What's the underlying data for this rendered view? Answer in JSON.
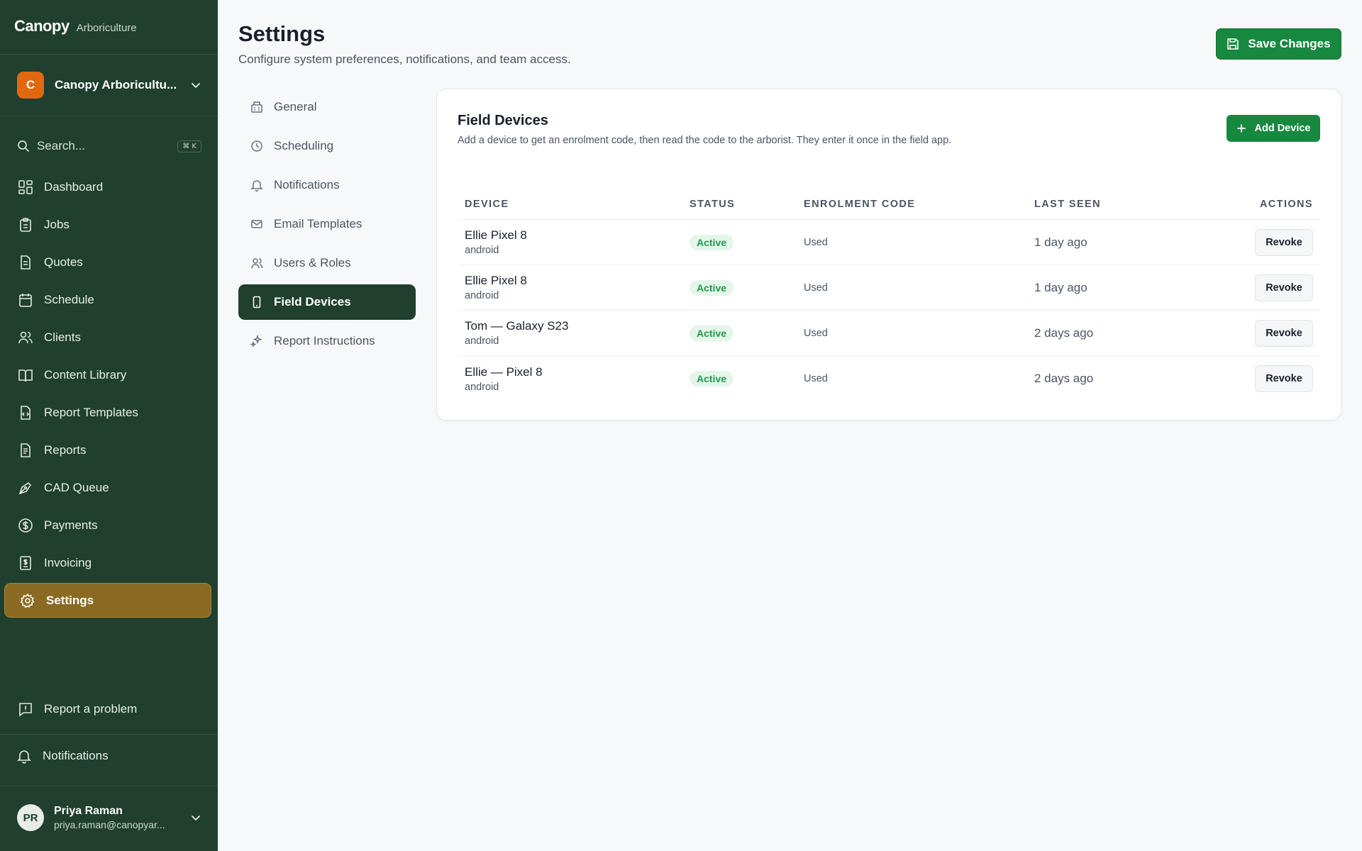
{
  "brand": {
    "name": "Canopy",
    "subtitle": "Arboriculture"
  },
  "org": {
    "initial": "C",
    "name": "Canopy Arboricultu..."
  },
  "search": {
    "placeholder": "Search...",
    "shortcut": "⌘ K"
  },
  "sidebar": {
    "items": [
      {
        "label": "Dashboard",
        "icon": "dashboard-icon"
      },
      {
        "label": "Jobs",
        "icon": "clipboard-icon"
      },
      {
        "label": "Quotes",
        "icon": "document-icon"
      },
      {
        "label": "Schedule",
        "icon": "calendar-icon"
      },
      {
        "label": "Clients",
        "icon": "users-icon"
      },
      {
        "label": "Content Library",
        "icon": "book-icon"
      },
      {
        "label": "Report Templates",
        "icon": "template-icon"
      },
      {
        "label": "Reports",
        "icon": "report-icon"
      },
      {
        "label": "CAD Queue",
        "icon": "pen-icon"
      },
      {
        "label": "Payments",
        "icon": "dollar-icon"
      },
      {
        "label": "Invoicing",
        "icon": "invoice-icon"
      },
      {
        "label": "Settings",
        "icon": "gear-icon",
        "active": true
      }
    ],
    "report_problem": "Report a problem",
    "notifications": "Notifications"
  },
  "user": {
    "initials": "PR",
    "name": "Priya Raman",
    "email": "priya.raman@canopyar..."
  },
  "header": {
    "title": "Settings",
    "subtitle": "Configure system preferences, notifications, and team access.",
    "save_label": "Save Changes"
  },
  "settings_nav": [
    {
      "label": "General",
      "icon": "building-icon"
    },
    {
      "label": "Scheduling",
      "icon": "clock-icon"
    },
    {
      "label": "Notifications",
      "icon": "bell-icon"
    },
    {
      "label": "Email Templates",
      "icon": "mail-icon"
    },
    {
      "label": "Users & Roles",
      "icon": "users-icon"
    },
    {
      "label": "Field Devices",
      "icon": "phone-icon",
      "active": true
    },
    {
      "label": "Report Instructions",
      "icon": "sparkle-icon"
    }
  ],
  "devices_card": {
    "title": "Field Devices",
    "description": "Add a device to get an enrolment code, then read the code to the arborist. They enter it once in the field app.",
    "add_label": "Add Device",
    "columns": [
      "DEVICE",
      "STATUS",
      "ENROLMENT CODE",
      "LAST SEEN",
      "ACTIONS"
    ],
    "rows": [
      {
        "name": "Ellie Pixel 8",
        "os": "android",
        "status": "Active",
        "code": "Used",
        "last_seen": "1 day ago",
        "action": "Revoke"
      },
      {
        "name": "Ellie Pixel 8",
        "os": "android",
        "status": "Active",
        "code": "Used",
        "last_seen": "1 day ago",
        "action": "Revoke"
      },
      {
        "name": "Tom — Galaxy S23",
        "os": "android",
        "status": "Active",
        "code": "Used",
        "last_seen": "2 days ago",
        "action": "Revoke"
      },
      {
        "name": "Ellie — Pixel 8",
        "os": "android",
        "status": "Active",
        "code": "Used",
        "last_seen": "2 days ago",
        "action": "Revoke"
      }
    ]
  },
  "colors": {
    "sidebar_bg": "#203f2e",
    "active_nav": "#8a6a22",
    "primary_button": "#17883f",
    "org_avatar": "#e0690f",
    "badge_bg": "#e3f6e9",
    "badge_text": "#1e9a4c"
  }
}
